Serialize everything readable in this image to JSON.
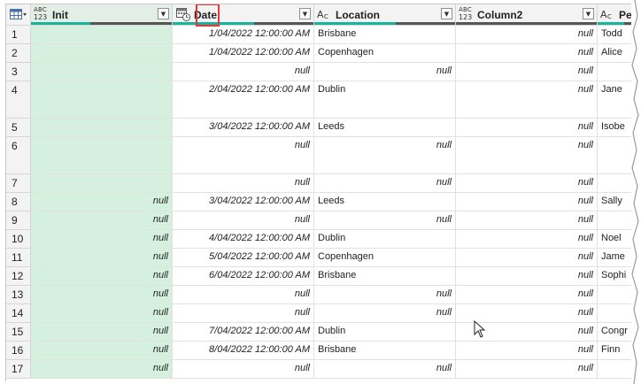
{
  "table": {
    "columns": [
      {
        "name": "Init",
        "type_top": "ABC",
        "type_bottom": "123",
        "good": 0.42
      },
      {
        "name": "Date",
        "type_icon": "calendar-clock-icon",
        "good": 0.58
      },
      {
        "name": "Location",
        "type_top": "A",
        "type_bottom": "C",
        "good": 0.58
      },
      {
        "name": "Column2",
        "type_top": "ABC",
        "type_bottom": "123",
        "good": 0.0
      },
      {
        "name": "Pe",
        "type_top": "A",
        "type_bottom": "C",
        "good": 0.5
      }
    ],
    "rows": [
      {
        "num": "1",
        "init": "",
        "date": "1/04/2022 12:00:00 AM",
        "location": "Brisbane",
        "column2": "null",
        "pe": "Todd"
      },
      {
        "num": "2",
        "init": "",
        "date": "1/04/2022 12:00:00 AM",
        "location": "Copenhagen",
        "column2": "null",
        "pe": "Alice"
      },
      {
        "num": "3",
        "init": "",
        "date": "null",
        "location": "null",
        "column2": "null",
        "pe": ""
      },
      {
        "num": "4",
        "init": "",
        "date": "2/04/2022 12:00:00 AM",
        "location": "Dublin",
        "column2": "null",
        "pe": "Jane"
      },
      {
        "num": "5",
        "init": "",
        "date": "3/04/2022 12:00:00 AM",
        "location": "Leeds",
        "column2": "null",
        "pe": "Isobe"
      },
      {
        "num": "6",
        "init": "",
        "date": "null",
        "location": "null",
        "column2": "null",
        "pe": ""
      },
      {
        "num": "7",
        "init": "",
        "date": "null",
        "location": "null",
        "column2": "null",
        "pe": ""
      },
      {
        "num": "8",
        "init": "null",
        "date": "3/04/2022 12:00:00 AM",
        "location": "Leeds",
        "column2": "null",
        "pe": "Sally"
      },
      {
        "num": "9",
        "init": "null",
        "date": "null",
        "location": "null",
        "column2": "null",
        "pe": ""
      },
      {
        "num": "10",
        "init": "null",
        "date": "4/04/2022 12:00:00 AM",
        "location": "Dublin",
        "column2": "null",
        "pe": "Noel"
      },
      {
        "num": "11",
        "init": "null",
        "date": "5/04/2022 12:00:00 AM",
        "location": "Copenhagen",
        "column2": "null",
        "pe": "Jame"
      },
      {
        "num": "12",
        "init": "null",
        "date": "6/04/2022 12:00:00 AM",
        "location": "Brisbane",
        "column2": "null",
        "pe": "Sophi"
      },
      {
        "num": "13",
        "init": "null",
        "date": "null",
        "location": "null",
        "column2": "null",
        "pe": ""
      },
      {
        "num": "14",
        "init": "null",
        "date": "null",
        "location": "null",
        "column2": "null",
        "pe": ""
      },
      {
        "num": "15",
        "init": "null",
        "date": "7/04/2022 12:00:00 AM",
        "location": "Dublin",
        "column2": "null",
        "pe": "Congr"
      },
      {
        "num": "16",
        "init": "null",
        "date": "8/04/2022 12:00:00 AM",
        "location": "Brisbane",
        "column2": "null",
        "pe": "Finn"
      },
      {
        "num": "17",
        "init": "null",
        "date": "null",
        "location": "null",
        "column2": "null",
        "pe": ""
      }
    ]
  },
  "colors": {
    "selected_column": "#d6f0e0",
    "quality_good": "#18b39b",
    "quality_rest": "#555555",
    "highlight": "#e03a3a"
  }
}
